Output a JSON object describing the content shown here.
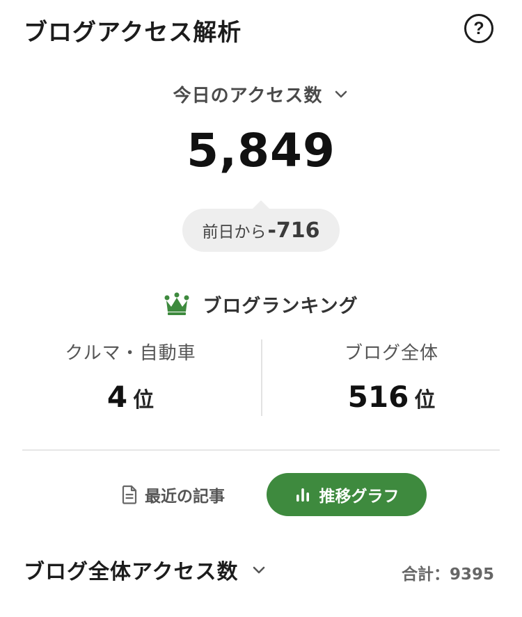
{
  "header": {
    "title": "ブログアクセス解析",
    "help_label": "?"
  },
  "period": {
    "label": "今日のアクセス数"
  },
  "access": {
    "count": "5,849",
    "diff_label": "前日から",
    "diff_value": "-716"
  },
  "ranking": {
    "title": "ブログランキング",
    "items": [
      {
        "category": "クルマ・自動車",
        "rank": "4",
        "unit": "位"
      },
      {
        "category": "ブログ全体",
        "rank": "516",
        "unit": "位"
      }
    ]
  },
  "tabs": [
    {
      "label": "最近の記事",
      "active": false
    },
    {
      "label": "推移グラフ",
      "active": true
    }
  ],
  "section": {
    "title": "ブログ全体アクセス数",
    "total": "合計：9395"
  },
  "colors": {
    "accent": "#3e8a3e",
    "crown": "#3e8a3e"
  },
  "icons": {
    "help": "help-icon",
    "chevron": "chevron-down-icon",
    "crown": "crown-icon",
    "document": "document-icon",
    "bar_chart": "bar-chart-icon"
  }
}
